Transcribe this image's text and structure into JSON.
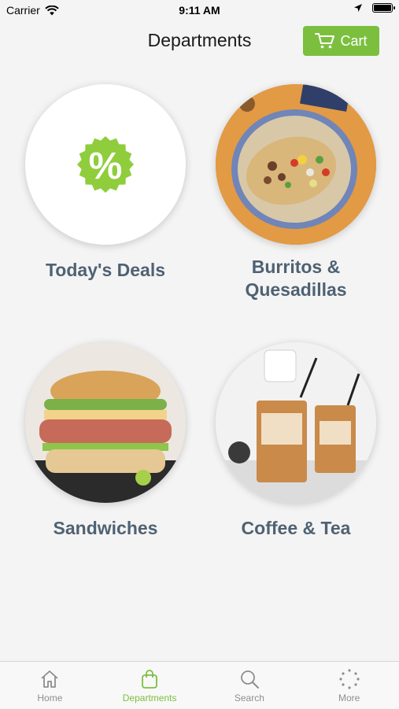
{
  "status_bar": {
    "carrier": "Carrier",
    "time": "9:11 AM",
    "battery_level": 1.0
  },
  "nav": {
    "title": "Departments",
    "cart_label": "Cart"
  },
  "departments": [
    {
      "label": "Today's Deals",
      "image": "deals-percent-badge"
    },
    {
      "label": "Burritos &\nQuesadillas",
      "image": "burrito-plate-photo"
    },
    {
      "label": "Sandwiches",
      "image": "sandwich-photo"
    },
    {
      "label": "Coffee & Tea",
      "image": "iced-coffee-photo"
    }
  ],
  "tabs": [
    {
      "label": "Home",
      "icon": "home-icon",
      "active": false
    },
    {
      "label": "Departments",
      "icon": "shopping-bag-icon",
      "active": true
    },
    {
      "label": "Search",
      "icon": "search-icon",
      "active": false
    },
    {
      "label": "More",
      "icon": "more-dots-icon",
      "active": false
    }
  ],
  "colors": {
    "accent": "#7cbf3f",
    "label": "#4f6273",
    "background": "#f4f4f4"
  }
}
